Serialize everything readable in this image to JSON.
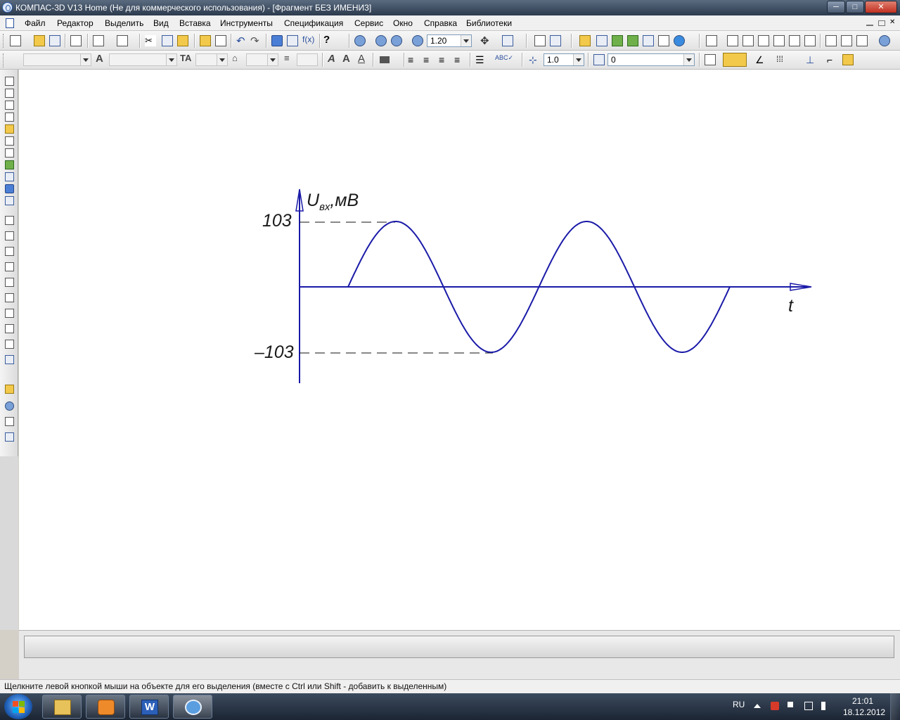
{
  "window": {
    "title": "КОМПАС-3D V13 Home (Не для коммерческого использования) - [Фрагмент БЕЗ ИМЕНИ3]",
    "minimize_glyph": "─",
    "maximize_glyph": "□",
    "close_glyph": "✕"
  },
  "menu": {
    "items": [
      "Файл",
      "Редактор",
      "Выделить",
      "Вид",
      "Вставка",
      "Инструменты",
      "Спецификация",
      "Сервис",
      "Окно",
      "Справка",
      "Библиотеки"
    ]
  },
  "toolbar1": {
    "zoom_value": "1.20"
  },
  "toolbar2": {
    "step_value": "1.0",
    "layer_value": "0"
  },
  "drawing": {
    "y_axis_label_main": "U",
    "y_axis_label_sub": "вх",
    "y_axis_label_unit": ",мВ",
    "x_axis_label": "t",
    "max_label": "103",
    "min_label": "–103",
    "line_color": "#1a1aa8"
  },
  "status": {
    "hint": "Щелкните левой кнопкой мыши на объекте для его выделения (вместе с Ctrl или Shift - добавить к выделенным)"
  },
  "taskbar": {
    "language": "RU",
    "time": "21:01",
    "date": "18.12.2012",
    "word_letter": "W"
  }
}
